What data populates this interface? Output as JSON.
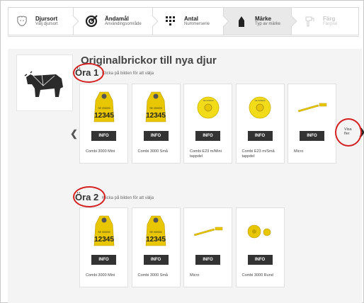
{
  "stepper": {
    "steps": [
      {
        "title": "Djursort",
        "subtitle": "Välj djursort",
        "icon": "animal-head-icon",
        "state": "done"
      },
      {
        "title": "Ändamål",
        "subtitle": "Användingsområde",
        "icon": "target-icon",
        "state": "done"
      },
      {
        "title": "Antal",
        "subtitle": "Nummerserie",
        "icon": "number-grid-icon",
        "state": "done"
      },
      {
        "title": "Märke",
        "subtitle": "Typ av märke",
        "icon": "ear-tag-icon",
        "state": "active"
      },
      {
        "title": "Färg",
        "subtitle": "Färgval",
        "icon": "paint-icon",
        "state": "disabled"
      }
    ]
  },
  "main": {
    "heading": "Originalbrickor till nya djur",
    "ear1": {
      "label": "Öra 1",
      "hint": "Klicka på bilden för att välja",
      "products": [
        {
          "name": "Combi 3000 Mini",
          "info": "INFO",
          "image": "yellow-tag-12345"
        },
        {
          "name": "Combi 3000 Små",
          "info": "INFO",
          "image": "yellow-tag-12345"
        },
        {
          "name": "Combi E23 m/Mini tappdel",
          "info": "INFO",
          "image": "round-yellow-tag"
        },
        {
          "name": "Combi E23 m/Små tappdel",
          "info": "INFO",
          "image": "round-yellow-tag"
        },
        {
          "name": "Micro",
          "info": "INFO",
          "image": "micro-strip-tag"
        }
      ]
    },
    "ear2": {
      "label": "Öra 2",
      "hint": "Klicka på bilden för att välja",
      "products": [
        {
          "name": "Combi 3000 Mini",
          "info": "INFO",
          "image": "yellow-tag-12345"
        },
        {
          "name": "Combi 3000 Små",
          "info": "INFO",
          "image": "yellow-tag-12345"
        },
        {
          "name": "Micro",
          "info": "INFO",
          "image": "micro-strip-tag"
        },
        {
          "name": "Combi 3000 Rund",
          "info": "INFO",
          "image": "round-button-tag"
        }
      ]
    },
    "show_more": "Visa fler",
    "tag_number": "12345",
    "annotation_color": "#d42020"
  }
}
